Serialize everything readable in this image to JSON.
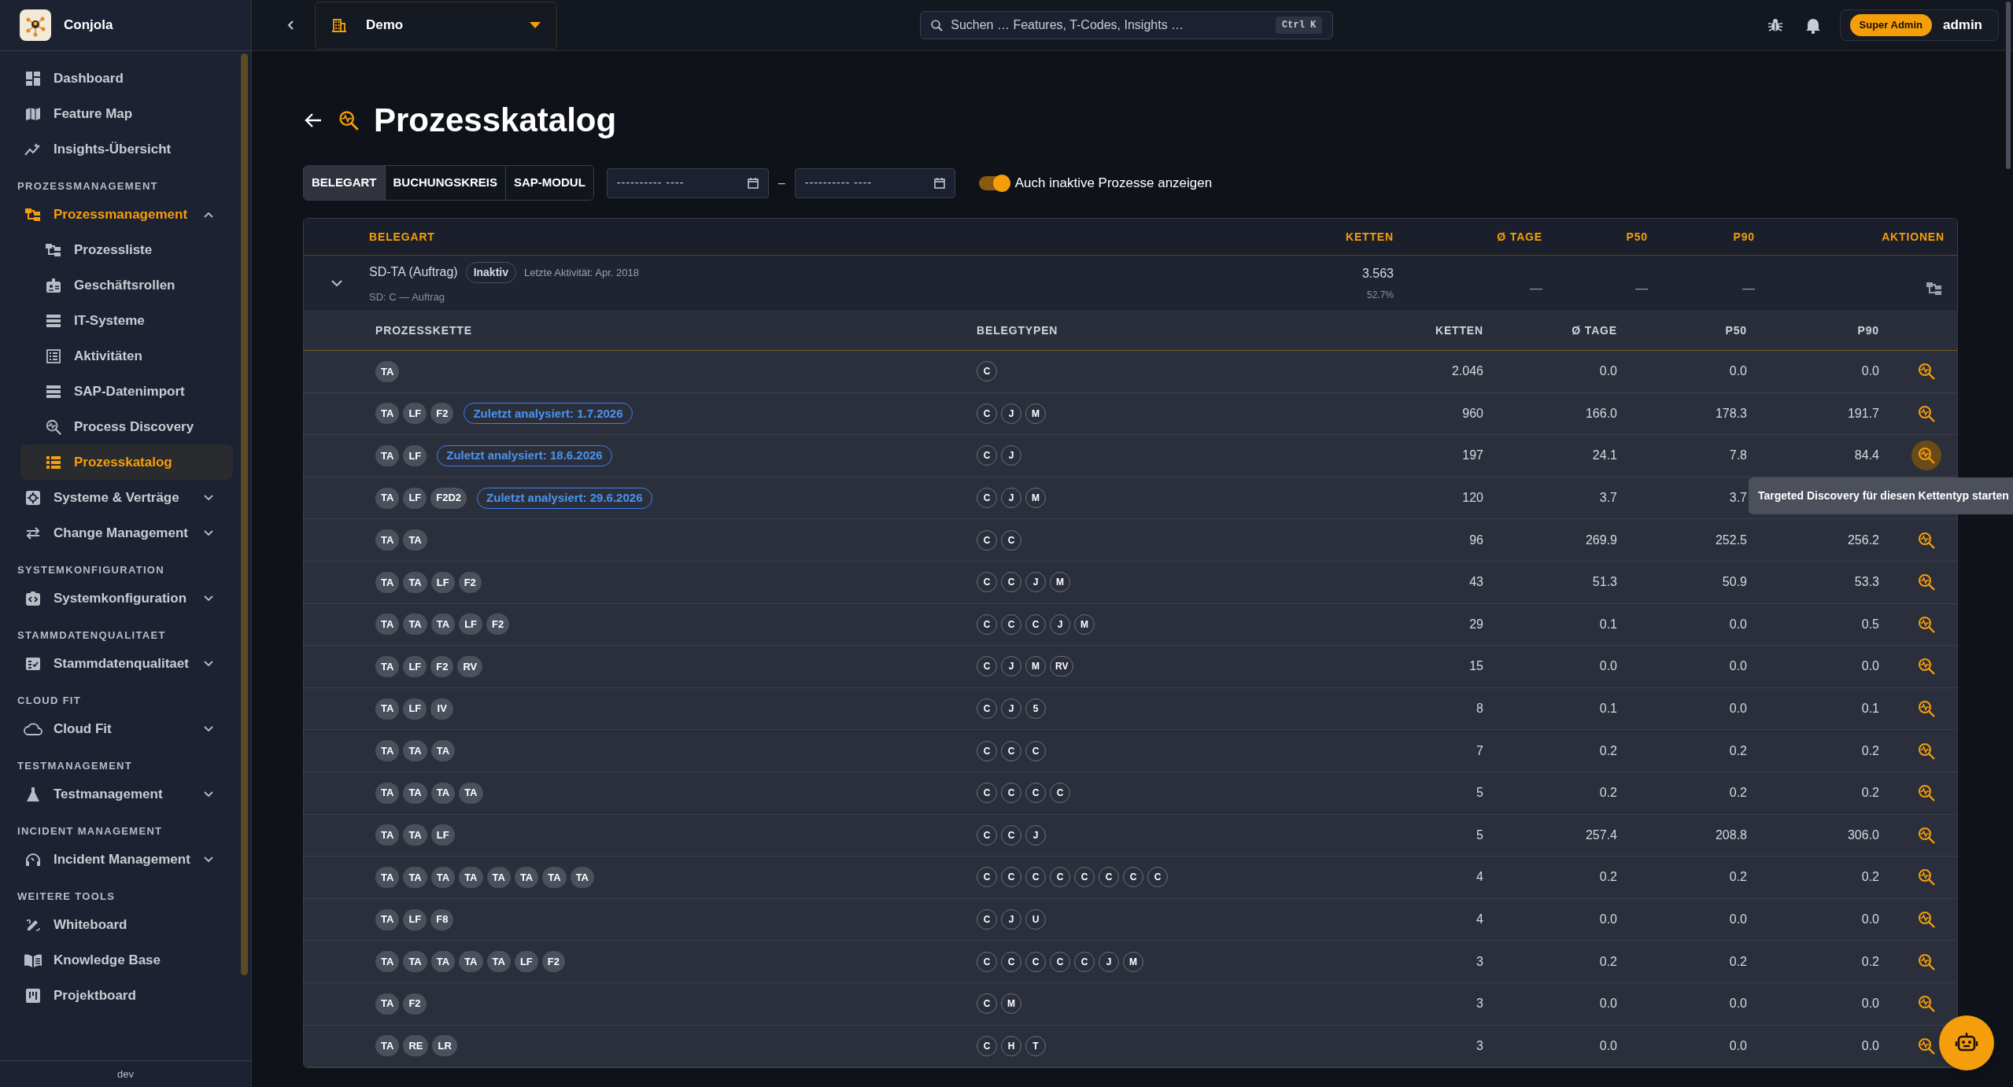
{
  "app": {
    "name": "Conjola"
  },
  "sidebar": {
    "items": [
      {
        "kind": "link",
        "label": "Dashboard",
        "selected": false
      },
      {
        "kind": "link",
        "label": "Feature Map",
        "selected": false
      },
      {
        "kind": "link",
        "label": "Insights-Übersicht",
        "selected": false
      },
      {
        "kind": "section",
        "label": "PROZESSMANAGEMENT"
      },
      {
        "kind": "group",
        "label": "Prozessmanagement",
        "expanded": true,
        "selected": true,
        "children": [
          {
            "label": "Prozessliste",
            "selected": false
          },
          {
            "label": "Geschäftsrollen",
            "selected": false
          },
          {
            "label": "IT-Systeme",
            "selected": false
          },
          {
            "label": "Aktivitäten",
            "selected": false
          },
          {
            "label": "SAP-Datenimport",
            "selected": false
          },
          {
            "label": "Process Discovery",
            "selected": false
          },
          {
            "label": "Prozesskatalog",
            "selected": true
          }
        ]
      },
      {
        "kind": "group",
        "label": "Systeme & Verträge",
        "expanded": false,
        "selected": false
      },
      {
        "kind": "group",
        "label": "Change Management",
        "expanded": false,
        "selected": false
      },
      {
        "kind": "section",
        "label": "SYSTEMKONFIGURATION"
      },
      {
        "kind": "group",
        "label": "Systemkonfiguration",
        "expanded": false,
        "selected": false
      },
      {
        "kind": "section",
        "label": "STAMMDATENQUALITAET"
      },
      {
        "kind": "group",
        "label": "Stammdatenqualitaet",
        "expanded": false,
        "selected": false
      },
      {
        "kind": "section",
        "label": "CLOUD FIT"
      },
      {
        "kind": "group",
        "label": "Cloud Fit",
        "expanded": false,
        "selected": false
      },
      {
        "kind": "section",
        "label": "TESTMANAGEMENT"
      },
      {
        "kind": "group",
        "label": "Testmanagement",
        "expanded": false,
        "selected": false
      },
      {
        "kind": "section",
        "label": "INCIDENT MANAGEMENT"
      },
      {
        "kind": "group",
        "label": "Incident Management",
        "expanded": false,
        "selected": false
      },
      {
        "kind": "section",
        "label": "WEITERE TOOLS"
      },
      {
        "kind": "link",
        "label": "Whiteboard",
        "selected": false
      },
      {
        "kind": "link",
        "label": "Knowledge Base",
        "selected": false
      },
      {
        "kind": "link",
        "label": "Projektboard",
        "selected": false
      }
    ],
    "footer": "dev"
  },
  "topbar": {
    "workspace": "Demo",
    "search": {
      "placeholder": "Suchen … Features, T-Codes, Insights …",
      "shortcut": "Ctrl K"
    },
    "role_badge": "Super Admin",
    "user": "admin"
  },
  "page": {
    "title": "Prozesskatalog"
  },
  "filters": {
    "group_by": [
      {
        "label": "BELEGART",
        "selected": true
      },
      {
        "label": "BUCHUNGSKREIS",
        "selected": false
      },
      {
        "label": "SAP-MODUL",
        "selected": false
      }
    ],
    "date_from": {
      "placeholder": "---------- ----"
    },
    "date_separator": "–",
    "date_to": {
      "placeholder": "---------- ----"
    },
    "show_inactive": {
      "label": "Auch inaktive Prozesse anzeigen",
      "on": true
    }
  },
  "table": {
    "columns": [
      "BELEGART",
      "KETTEN",
      "Ø TAGE",
      "P50",
      "P90",
      "AKTIONEN"
    ],
    "groups": [
      {
        "expanded": true,
        "name": "SD-TA (Auftrag)",
        "status": "Inaktiv",
        "last_activity": "Letzte Aktivität: Apr. 2018",
        "subtitle": "SD: C — Auftrag",
        "ketten": "3.563",
        "share": "52.7%",
        "tage": "—",
        "p50": "—",
        "p90": "—",
        "sub_columns": [
          "PROZESSKETTE",
          "BELEGTYPEN",
          "KETTEN",
          "Ø TAGE",
          "P50",
          "P90"
        ],
        "rows": [
          {
            "chain": [
              "TA"
            ],
            "types": [
              "C"
            ],
            "ketten": "2.046",
            "tage": "0.0",
            "p50": "0.0",
            "p90": "0.0",
            "action": {
              "hovered": false
            }
          },
          {
            "chain": [
              "TA",
              "LF",
              "F2"
            ],
            "analyzed": "Zuletzt analysiert: 1.7.2026",
            "types": [
              "C",
              "J",
              "M"
            ],
            "ketten": "960",
            "tage": "166.0",
            "p50": "178.3",
            "p90": "191.7",
            "action": {
              "hovered": false
            }
          },
          {
            "chain": [
              "TA",
              "LF"
            ],
            "analyzed": "Zuletzt analysiert: 18.6.2026",
            "types": [
              "C",
              "J"
            ],
            "ketten": "197",
            "tage": "24.1",
            "p50": "7.8",
            "p90": "84.4",
            "action": {
              "hovered": true
            }
          },
          {
            "chain": [
              "TA",
              "LF",
              "F2D2"
            ],
            "analyzed": "Zuletzt analysiert: 29.6.2026",
            "types": [
              "C",
              "J",
              "M"
            ],
            "ketten": "120",
            "tage": "3.7",
            "p50": "3.7"
          },
          {
            "chain": [
              "TA",
              "TA"
            ],
            "types": [
              "C",
              "C"
            ],
            "ketten": "96",
            "tage": "269.9",
            "p50": "252.5",
            "p90": "256.2",
            "action": {
              "hovered": false
            }
          },
          {
            "chain": [
              "TA",
              "TA",
              "LF",
              "F2"
            ],
            "types": [
              "C",
              "C",
              "J",
              "M"
            ],
            "ketten": "43",
            "tage": "51.3",
            "p50": "50.9",
            "p90": "53.3",
            "action": {
              "hovered": false
            }
          },
          {
            "chain": [
              "TA",
              "TA",
              "TA",
              "LF",
              "F2"
            ],
            "types": [
              "C",
              "C",
              "C",
              "J",
              "M"
            ],
            "ketten": "29",
            "tage": "0.1",
            "p50": "0.0",
            "p90": "0.5",
            "action": {
              "hovered": false
            }
          },
          {
            "chain": [
              "TA",
              "LF",
              "F2",
              "RV"
            ],
            "types": [
              "C",
              "J",
              "M",
              "RV"
            ],
            "ketten": "15",
            "tage": "0.0",
            "p50": "0.0",
            "p90": "0.0",
            "action": {
              "hovered": false
            }
          },
          {
            "chain": [
              "TA",
              "LF",
              "IV"
            ],
            "types": [
              "C",
              "J",
              "5"
            ],
            "ketten": "8",
            "tage": "0.1",
            "p50": "0.0",
            "p90": "0.1",
            "action": {
              "hovered": false
            }
          },
          {
            "chain": [
              "TA",
              "TA",
              "TA"
            ],
            "types": [
              "C",
              "C",
              "C"
            ],
            "ketten": "7",
            "tage": "0.2",
            "p50": "0.2",
            "p90": "0.2",
            "action": {
              "hovered": false
            }
          },
          {
            "chain": [
              "TA",
              "TA",
              "TA",
              "TA"
            ],
            "types": [
              "C",
              "C",
              "C",
              "C"
            ],
            "ketten": "5",
            "tage": "0.2",
            "p50": "0.2",
            "p90": "0.2",
            "action": {
              "hovered": false
            }
          },
          {
            "chain": [
              "TA",
              "TA",
              "LF"
            ],
            "types": [
              "C",
              "C",
              "J"
            ],
            "ketten": "5",
            "tage": "257.4",
            "p50": "208.8",
            "p90": "306.0",
            "action": {
              "hovered": false
            }
          },
          {
            "chain": [
              "TA",
              "TA",
              "TA",
              "TA",
              "TA",
              "TA",
              "TA",
              "TA"
            ],
            "types": [
              "C",
              "C",
              "C",
              "C",
              "C",
              "C",
              "C",
              "C"
            ],
            "ketten": "4",
            "tage": "0.2",
            "p50": "0.2",
            "p90": "0.2",
            "action": {
              "hovered": false
            }
          },
          {
            "chain": [
              "TA",
              "LF",
              "F8"
            ],
            "types": [
              "C",
              "J",
              "U"
            ],
            "ketten": "4",
            "tage": "0.0",
            "p50": "0.0",
            "p90": "0.0",
            "action": {
              "hovered": false
            }
          },
          {
            "chain": [
              "TA",
              "TA",
              "TA",
              "TA",
              "TA",
              "LF",
              "F2"
            ],
            "types": [
              "C",
              "C",
              "C",
              "C",
              "C",
              "J",
              "M"
            ],
            "ketten": "3",
            "tage": "0.2",
            "p50": "0.2",
            "p90": "0.2",
            "action": {
              "hovered": false
            }
          },
          {
            "chain": [
              "TA",
              "F2"
            ],
            "types": [
              "C",
              "M"
            ],
            "ketten": "3",
            "tage": "0.0",
            "p50": "0.0",
            "p90": "0.0",
            "action": {
              "hovered": false
            }
          },
          {
            "chain": [
              "TA",
              "RE",
              "LR"
            ],
            "types": [
              "C",
              "H",
              "T"
            ],
            "ketten": "3",
            "tage": "0.0",
            "p50": "0.0",
            "p90": "0.0",
            "action": {
              "hovered": false
            }
          }
        ]
      }
    ]
  },
  "tooltip": "Targeted Discovery für diesen Kettentyp starten"
}
